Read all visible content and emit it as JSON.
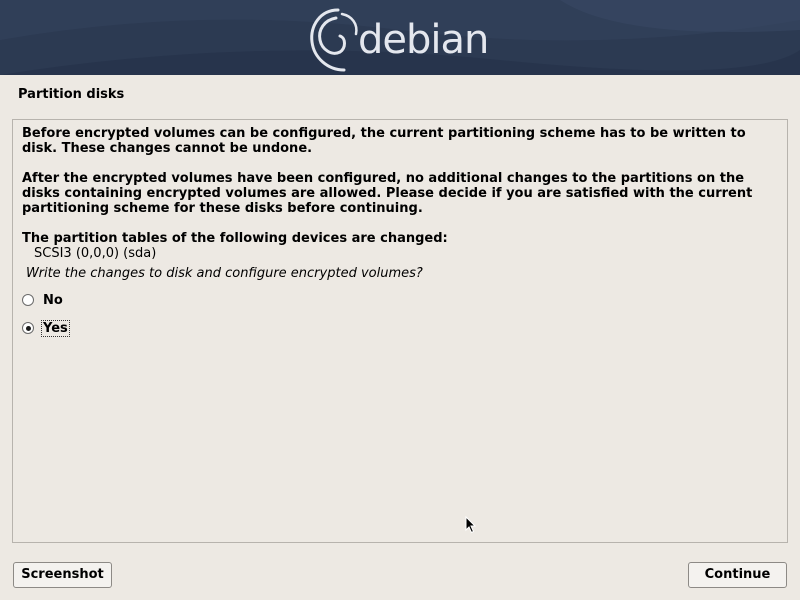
{
  "banner": {
    "brand": "debian",
    "logo_icon": "debian-swirl-icon",
    "background_color": "#2c3a52"
  },
  "step": {
    "title": "Partition disks"
  },
  "message": {
    "paragraph1": "Before encrypted volumes can be configured, the current partitioning scheme has to be written to disk. These changes cannot be undone.",
    "paragraph2": "After the encrypted volumes have been configured, no additional changes to the partitions on the disks containing encrypted volumes are allowed. Please decide if you are satisfied with the current partitioning scheme for these disks before continuing.",
    "paragraph3": "The partition tables of the following devices are changed:",
    "device": "SCSI3 (0,0,0) (sda)",
    "question": "Write the changes to disk and configure encrypted volumes?"
  },
  "options": [
    {
      "label": "No",
      "selected": false
    },
    {
      "label": "Yes",
      "selected": true
    }
  ],
  "buttons": {
    "screenshot": "Screenshot",
    "continue": "Continue"
  }
}
